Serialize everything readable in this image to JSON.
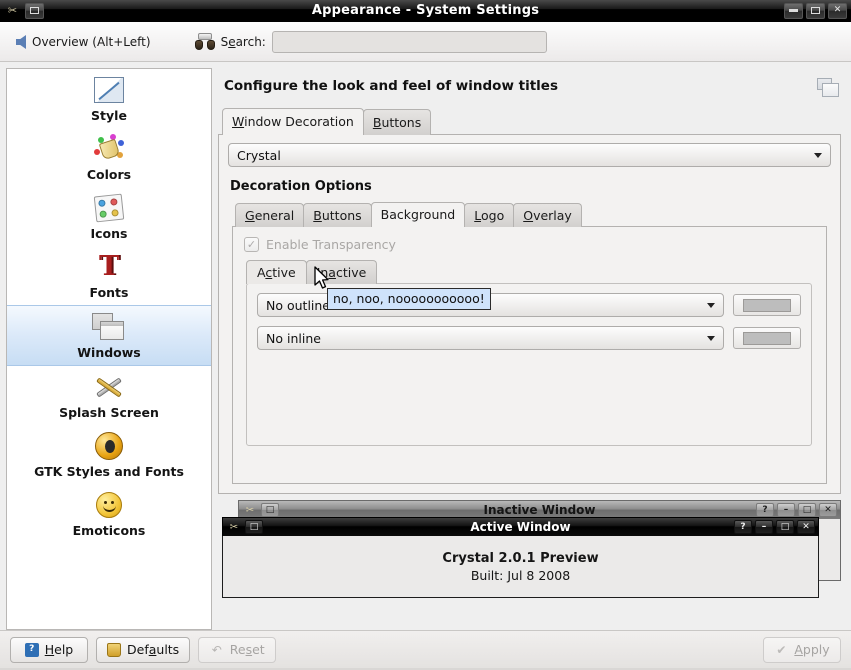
{
  "window": {
    "title": "Appearance - System Settings",
    "menu_icon": "tools-icon",
    "shade_icon": "window-icon",
    "minimize_label": "–",
    "maximize_label": "□",
    "close_label": "✕"
  },
  "toolbar": {
    "overview_label": "Overview (Alt+Left)",
    "search_icon": "binoculars-icon",
    "search_label_pre": "S",
    "search_label_accel": "e",
    "search_label_post": "arch:",
    "search_value": "",
    "search_placeholder": ""
  },
  "sidebar": {
    "items": [
      {
        "label": "Style",
        "icon": "style-icon",
        "selected": false
      },
      {
        "label": "Colors",
        "icon": "colors-icon",
        "selected": false
      },
      {
        "label": "Icons",
        "icon": "icons-icon",
        "selected": false
      },
      {
        "label": "Fonts",
        "icon": "fonts-icon",
        "selected": false
      },
      {
        "label": "Windows",
        "icon": "windows-icon",
        "selected": true
      },
      {
        "label": "Splash Screen",
        "icon": "splash-screen-icon",
        "selected": false
      },
      {
        "label": "GTK Styles and Fonts",
        "icon": "gtk-styles-icon",
        "selected": false
      },
      {
        "label": "Emoticons",
        "icon": "emoticons-icon",
        "selected": false
      }
    ]
  },
  "main": {
    "heading": "Configure the look and feel of window titles",
    "header_icon": "window-decoration-icon",
    "tabs": [
      {
        "accel": "W",
        "rest": "indow Decoration",
        "active": true
      },
      {
        "accel": "B",
        "rest": "uttons",
        "active": false
      }
    ],
    "theme_combo": {
      "value": "Crystal"
    },
    "group_title": "Decoration Options",
    "inner_tabs": [
      {
        "accel": "G",
        "rest": "eneral",
        "active": false
      },
      {
        "accel": "B",
        "rest": "uttons",
        "active": false
      },
      {
        "accel": "",
        "rest": "Background",
        "active": true
      },
      {
        "accel": "L",
        "rest": "ogo",
        "active": false
      },
      {
        "accel": "O",
        "rest": "verlay",
        "active": false
      }
    ],
    "transparency": {
      "label": "Enable Transparency",
      "checked": true,
      "enabled": false,
      "check_glyph": "✓"
    },
    "state_tabs": [
      {
        "pre": "A",
        "accel": "c",
        "post": "tive",
        "active": true
      },
      {
        "pre": "In",
        "accel": "a",
        "post": "ctive",
        "active": false
      }
    ],
    "options": [
      {
        "combo_value": "No outline",
        "color_button": "outline-color-button"
      },
      {
        "combo_value": "No inline",
        "color_button": "inline-color-button"
      }
    ]
  },
  "tooltip": {
    "text": "no, noo, nooooooooooo!"
  },
  "preview": {
    "inactive": {
      "title": "Inactive Window",
      "app_icon": "app-icon",
      "shade_icon": "shade-icon",
      "buttons": [
        "?",
        "–",
        "□",
        "✕"
      ]
    },
    "active": {
      "title": "Active Window",
      "app_icon": "app-icon",
      "shade_icon": "shade-icon",
      "buttons": [
        "?",
        "–",
        "□",
        "✕"
      ],
      "line1": "Crystal 2.0.1 Preview",
      "line2": "Built: Jul 8 2008"
    }
  },
  "footer": {
    "help": {
      "pre": "",
      "accel": "H",
      "post": "elp",
      "enabled": true
    },
    "defaults": {
      "pre": "Def",
      "accel": "a",
      "post": "ults",
      "enabled": true
    },
    "reset": {
      "pre": "Re",
      "accel": "s",
      "post": "et",
      "enabled": false
    },
    "apply": {
      "pre": "",
      "accel": "A",
      "post": "pply",
      "enabled": false
    }
  },
  "colors": {
    "titlebar_bg": "#000000",
    "selection": "#c7ddf4",
    "tooltip_bg": "#cfe3fb",
    "panel_bg": "#f3f2f1",
    "app_bg": "#efefef"
  }
}
